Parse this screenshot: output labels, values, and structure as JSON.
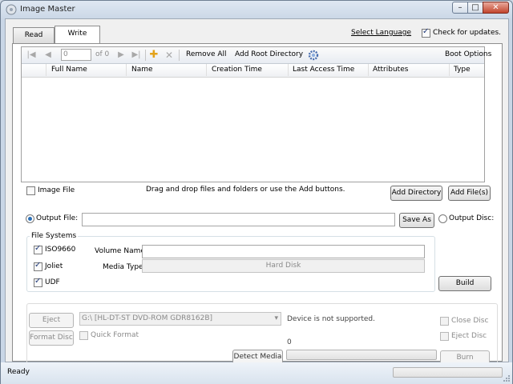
{
  "window": {
    "title": "Image Master"
  },
  "tabs": [
    {
      "label": "Read"
    },
    {
      "label": "Write"
    }
  ],
  "header": {
    "select_language": "Select Language",
    "check_updates": "Check for updates.",
    "check_updates_checked": true
  },
  "toolbar": {
    "page_value": "0",
    "page_of": "of 0",
    "remove_all": "Remove All",
    "add_root_directory": "Add Root Directory",
    "boot_options": "Boot Options"
  },
  "table": {
    "columns": [
      "Full Name",
      "Name",
      "Creation Time",
      "Last Access Time",
      "Attributes",
      "Type"
    ],
    "rows": []
  },
  "file_area": {
    "image_file_label": "Image File",
    "image_file_checked": false,
    "hint": "Drag and drop files and folders or use the Add buttons.",
    "add_directory": "Add Directory",
    "add_files": "Add File(s)"
  },
  "output": {
    "file_label": "Output File:",
    "file_value": "",
    "save_as": "Save As",
    "disc_label": "Output Disc:"
  },
  "file_systems": {
    "title": "File Systems",
    "iso9660": "ISO9660",
    "joliet": "Joliet",
    "udf": "UDF",
    "volume_name_label": "Volume Name:",
    "volume_name_value": "",
    "media_type_label": "Media Type:",
    "media_type_value": "Hard Disk",
    "build": "Build"
  },
  "disc": {
    "eject": "Eject",
    "format_disc": "Format Disc",
    "quick_format": "Quick Format",
    "drive_value": "G:\\ [HL-DT-ST DVD-ROM GDR8162B]",
    "status": "Device is not supported.",
    "progress_value": "0",
    "progress_fraction": 0,
    "detect_media": "Detect Media",
    "close_disc": "Close Disc",
    "eject_disc": "Eject Disc",
    "burn": "Burn"
  },
  "status": {
    "text": "Ready",
    "progress_fraction": 0
  }
}
